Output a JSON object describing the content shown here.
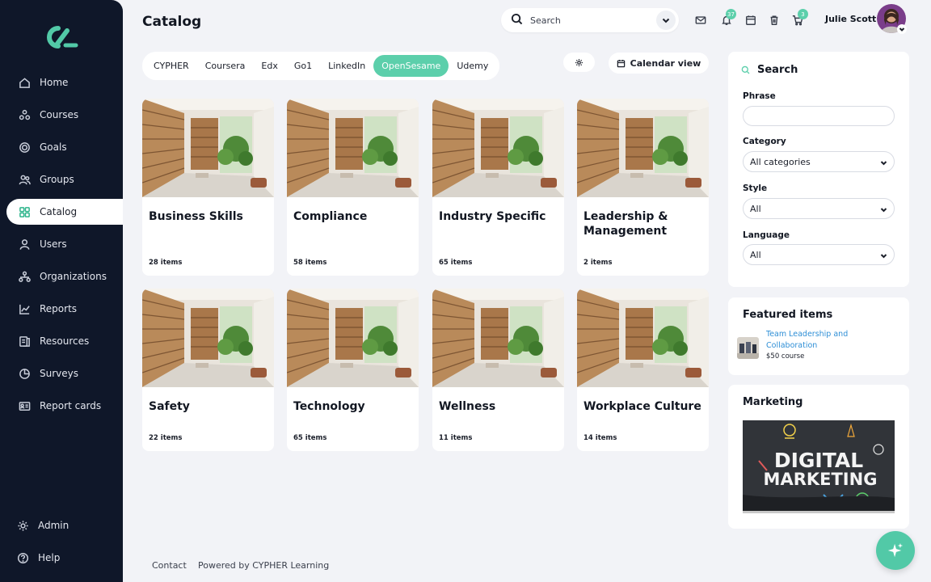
{
  "app": {
    "title": "Catalog"
  },
  "sidebar": {
    "items": [
      {
        "label": "Home",
        "icon": "home-icon"
      },
      {
        "label": "Courses",
        "icon": "courses-icon"
      },
      {
        "label": "Goals",
        "icon": "goals-icon"
      },
      {
        "label": "Groups",
        "icon": "groups-icon"
      },
      {
        "label": "Catalog",
        "icon": "catalog-icon",
        "active": true
      },
      {
        "label": "Users",
        "icon": "user-icon"
      },
      {
        "label": "Organizations",
        "icon": "organizations-icon"
      },
      {
        "label": "Reports",
        "icon": "reports-icon"
      },
      {
        "label": "Resources",
        "icon": "resources-icon"
      },
      {
        "label": "Surveys",
        "icon": "surveys-icon"
      },
      {
        "label": "Report cards",
        "icon": "report-cards-icon"
      }
    ],
    "bottom": [
      {
        "label": "Admin",
        "icon": "gear-icon"
      },
      {
        "label": "Help",
        "icon": "help-icon"
      }
    ]
  },
  "header": {
    "search_placeholder": "Search",
    "notifications_count": "37",
    "cart_count": "3",
    "user_name": "Julie Scott"
  },
  "providers": {
    "tabs": [
      "CYPHER",
      "Coursera",
      "Edx",
      "Go1",
      "LinkedIn",
      "OpenSesame",
      "Udemy"
    ],
    "active": "OpenSesame"
  },
  "toolbar": {
    "calendar_view": "Calendar view"
  },
  "categories": [
    {
      "title": "Business Skills",
      "count": "28 items"
    },
    {
      "title": "Compliance",
      "count": "58 items"
    },
    {
      "title": "Industry Specific",
      "count": "65 items"
    },
    {
      "title": "Leadership & Management",
      "count": "2 items"
    },
    {
      "title": "Safety",
      "count": "22 items"
    },
    {
      "title": "Technology",
      "count": "65 items"
    },
    {
      "title": "Wellness",
      "count": "11 items"
    },
    {
      "title": "Workplace Culture",
      "count": "14 items"
    }
  ],
  "filters": {
    "heading": "Search",
    "phrase_label": "Phrase",
    "phrase_value": "",
    "category_label": "Category",
    "category_value": "All categories",
    "style_label": "Style",
    "style_value": "All",
    "language_label": "Language",
    "language_value": "All"
  },
  "featured": {
    "heading": "Featured items",
    "item_title": "Team Leadership and Collaboration",
    "item_price": "$50 course"
  },
  "marketing": {
    "heading": "Marketing",
    "image_text_1": "DIGITAL",
    "image_text_2": "MARKETING"
  },
  "footer": {
    "contact": "Contact",
    "powered": "Powered by CYPHER Learning"
  },
  "colors": {
    "sidebar_bg": "#0f1729",
    "accent": "#5ccfab",
    "link": "#2f8fd6",
    "page_bg": "#f2f3f7"
  }
}
